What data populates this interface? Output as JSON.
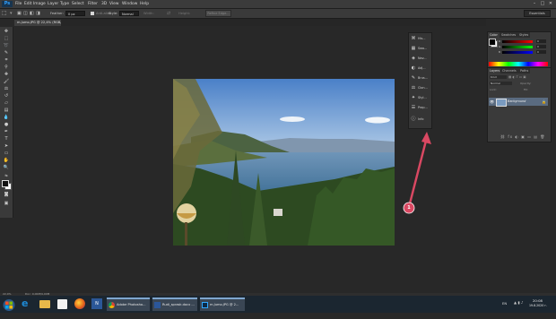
{
  "menubar": {
    "app_logo": "Ps",
    "items": [
      "File",
      "Edit",
      "Image",
      "Layer",
      "Type",
      "Select",
      "Filter",
      "3D",
      "View",
      "Window",
      "Help"
    ],
    "window_controls": [
      "–",
      "□",
      "✕"
    ]
  },
  "options": {
    "feather_label": "Feather:",
    "feather_value": "0 px",
    "antialias_label": "Anti-alias",
    "style_label": "Style:",
    "style_value": "Normal",
    "width_label": "Width:",
    "height_label": "Height:",
    "refine_edge": "Refine Edge...",
    "workspace": "Essentials"
  },
  "document": {
    "tab_title": "m.Jumo.JPG @ 22,4% (RGB/8)"
  },
  "mini_panel": {
    "items": [
      {
        "icon": "history-icon",
        "label": "His..."
      },
      {
        "icon": "swatches-icon",
        "label": "Swa..."
      },
      {
        "icon": "navigator-icon",
        "label": "Nav..."
      },
      {
        "icon": "adjustments-icon",
        "label": "Adj..."
      },
      {
        "icon": "brush-icon",
        "label": "Brus..."
      },
      {
        "icon": "clone-icon",
        "label": "Clon..."
      },
      {
        "icon": "styles-icon",
        "label": "Styl..."
      },
      {
        "icon": "properties-icon",
        "label": "Prop..."
      },
      {
        "icon": "info-icon",
        "label": "Info"
      }
    ]
  },
  "color_panel": {
    "tabs": [
      "Color",
      "Swatches",
      "Styles"
    ],
    "channels": [
      "R",
      "G",
      "B"
    ],
    "values": [
      "0",
      "0",
      "0"
    ]
  },
  "layers_panel": {
    "tabs": [
      "Layers",
      "Channels",
      "Paths"
    ],
    "kind_label": "Kind",
    "blend_mode": "Normal",
    "opacity_label": "Opacity:",
    "lock_label": "Lock:",
    "fill_label": "Fill:",
    "layer_name": "Background"
  },
  "annotation": {
    "marker": "1"
  },
  "statusbar": {
    "zoom": "22,4%",
    "doc": "Doc: 9,00M/9,00M"
  },
  "taskbar": {
    "tasks": [
      {
        "label": "Adobe Photosho...",
        "icon": "chrome-icon"
      },
      {
        "label": "Rudi_sprask.docx ...",
        "icon": "word-icon"
      },
      {
        "label": "m.Jumo.JPG @ 2...",
        "icon": "photoshop-icon"
      }
    ],
    "lang": "EN",
    "time": "20:08",
    "date": "19.8.2020 г."
  },
  "colors": {
    "accent": "#31a8ff",
    "annotation": "#d94862",
    "panel": "#3a3a3a",
    "workspace_bg": "#282828"
  }
}
